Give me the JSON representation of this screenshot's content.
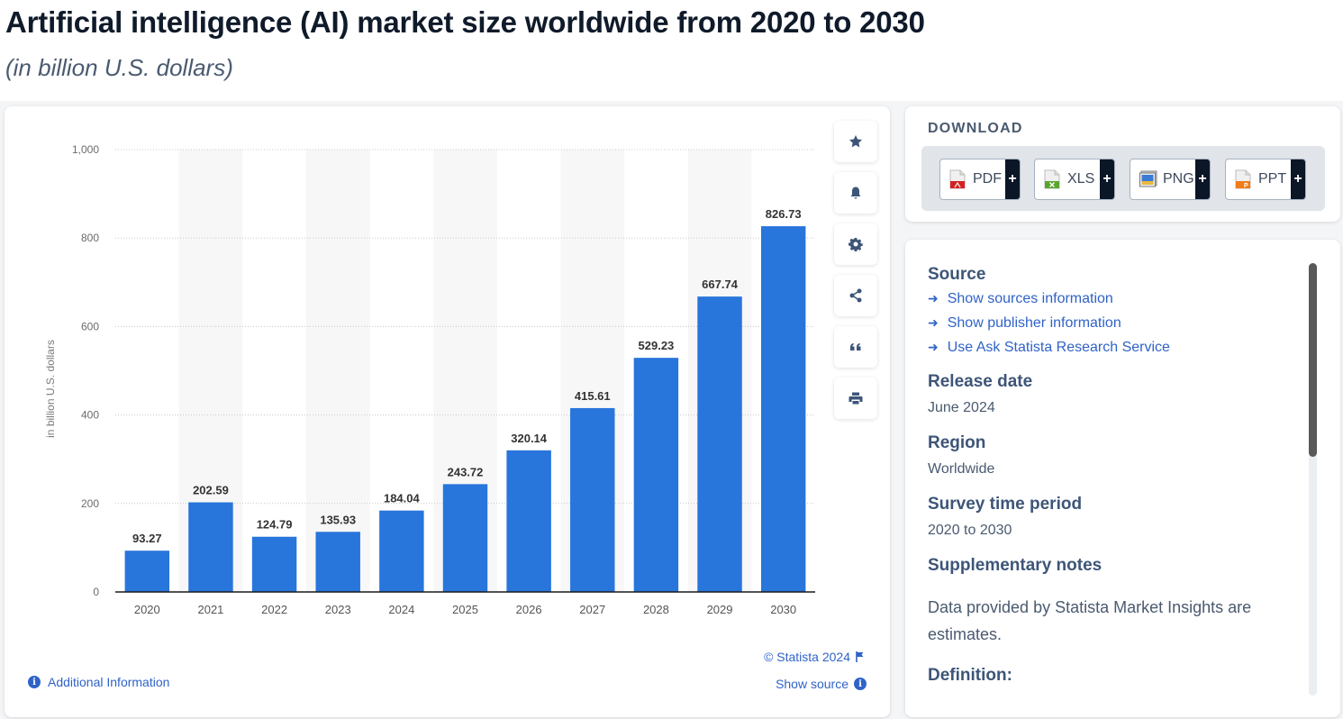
{
  "header": {
    "title": "Artificial intelligence (AI) market size worldwide from 2020 to 2030",
    "subtitle": "(in billion U.S. dollars)"
  },
  "toolbar": {
    "buttons": [
      {
        "name": "favorite",
        "icon": "star-icon"
      },
      {
        "name": "notify",
        "icon": "bell-icon"
      },
      {
        "name": "settings",
        "icon": "gear-icon"
      },
      {
        "name": "share",
        "icon": "share-icon"
      },
      {
        "name": "cite",
        "icon": "quote-icon"
      },
      {
        "name": "print",
        "icon": "printer-icon"
      }
    ]
  },
  "footer": {
    "copyright": "© Statista 2024",
    "show_source": "Show source",
    "additional_info": "Additional Information"
  },
  "download": {
    "title": "DOWNLOAD",
    "buttons": [
      {
        "label": "PDF",
        "icon": "pdf-file-icon",
        "color": "#d42222"
      },
      {
        "label": "XLS",
        "icon": "xls-file-icon",
        "color": "#5aa62c"
      },
      {
        "label": "PNG",
        "icon": "png-image-icon",
        "color": "#3a7bd5"
      },
      {
        "label": "PPT",
        "icon": "ppt-file-icon",
        "color": "#f07d1a"
      }
    ],
    "plus": "+"
  },
  "meta": {
    "source_heading": "Source",
    "links": [
      "Show sources information",
      "Show publisher information",
      "Use Ask Statista Research Service"
    ],
    "release_heading": "Release date",
    "release_value": "June 2024",
    "region_heading": "Region",
    "region_value": "Worldwide",
    "period_heading": "Survey time period",
    "period_value": "2020 to 2030",
    "notes_heading": "Supplementary notes",
    "notes_value": "Data provided by Statista Market Insights are estimates.",
    "definition_heading": "Definition:"
  },
  "colors": {
    "bar": "#2875db",
    "link": "#2f63c8",
    "heading": "#3d5578"
  },
  "chart_data": {
    "type": "bar",
    "title": "Artificial intelligence (AI) market size worldwide from 2020 to 2030",
    "subtitle": "(in billion U.S. dollars)",
    "xlabel": "",
    "ylabel": "in billion U.S. dollars",
    "categories": [
      "2020",
      "2021",
      "2022",
      "2023",
      "2024",
      "2025",
      "2026",
      "2027",
      "2028",
      "2029",
      "2030"
    ],
    "values": [
      93.27,
      202.59,
      124.79,
      135.93,
      184.04,
      243.72,
      320.14,
      415.61,
      529.23,
      667.74,
      826.73
    ],
    "value_labels": [
      "93.27",
      "202.59",
      "124.79",
      "135.93",
      "184.04",
      "243.72",
      "320.14",
      "415.61",
      "529.23",
      "667.74",
      "826.73"
    ],
    "ylim": [
      0,
      1000
    ],
    "yticks": [
      0,
      200,
      400,
      600,
      800,
      1000
    ],
    "ytick_labels": [
      "0",
      "200",
      "400",
      "600",
      "800",
      "1,000"
    ],
    "grid": true,
    "legend": "none",
    "alternating_column_shading": true
  }
}
